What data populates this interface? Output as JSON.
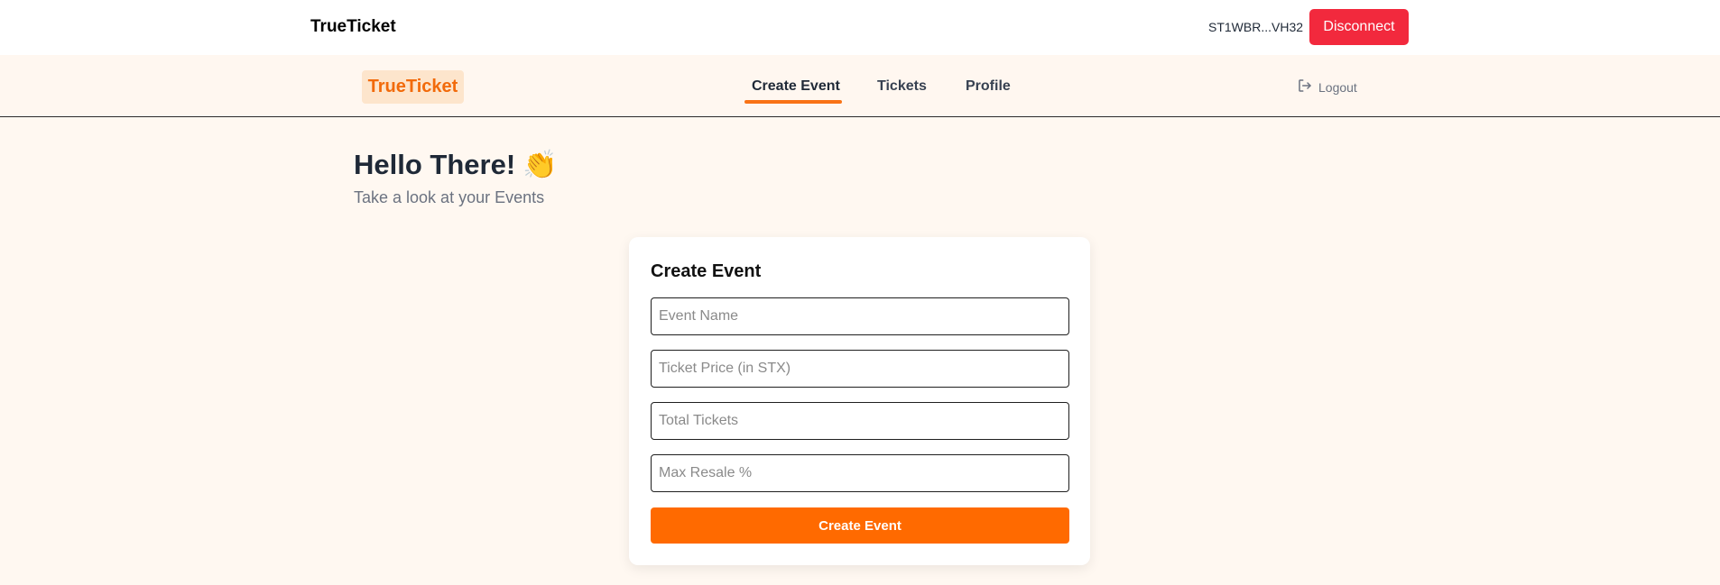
{
  "topbar": {
    "brand": "TrueTicket",
    "wallet_address": "ST1WBR...VH32",
    "disconnect_label": "Disconnect"
  },
  "navbar": {
    "logo": "TrueTicket",
    "tabs": [
      {
        "label": "Create Event",
        "active": true
      },
      {
        "label": "Tickets",
        "active": false
      },
      {
        "label": "Profile",
        "active": false
      }
    ],
    "logout_label": "Logout"
  },
  "greeting": {
    "title": "Hello There!",
    "emoji": "👏",
    "subtitle": "Take a look at your Events"
  },
  "form": {
    "title": "Create Event",
    "fields": [
      {
        "placeholder": "Event Name",
        "value": ""
      },
      {
        "placeholder": "Ticket Price (in STX)",
        "value": ""
      },
      {
        "placeholder": "Total Tickets",
        "value": ""
      },
      {
        "placeholder": "Max Resale %",
        "value": ""
      }
    ],
    "submit_label": "Create Event"
  },
  "colors": {
    "accent": "#ff6a00",
    "disconnect": "#f2293d",
    "logo_bg": "#fde5cc",
    "page_bg": "#fff8f1"
  }
}
